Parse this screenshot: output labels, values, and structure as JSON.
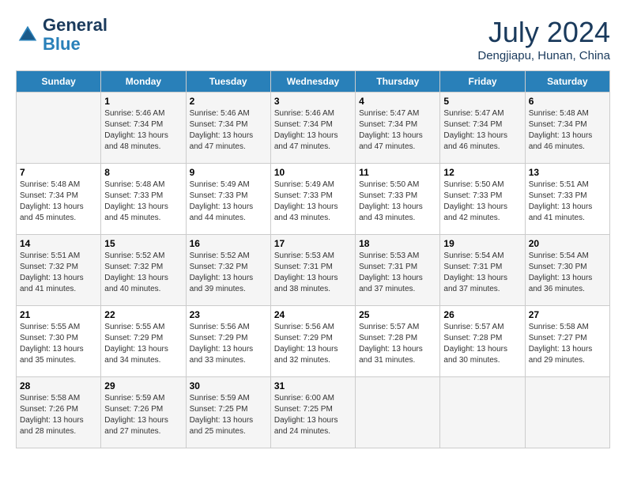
{
  "header": {
    "logo_line1": "General",
    "logo_line2": "Blue",
    "month_title": "July 2024",
    "location": "Dengjiapu, Hunan, China"
  },
  "calendar": {
    "days_of_week": [
      "Sunday",
      "Monday",
      "Tuesday",
      "Wednesday",
      "Thursday",
      "Friday",
      "Saturday"
    ],
    "weeks": [
      [
        {
          "day": "",
          "content": ""
        },
        {
          "day": "1",
          "content": "Sunrise: 5:46 AM\nSunset: 7:34 PM\nDaylight: 13 hours\nand 48 minutes."
        },
        {
          "day": "2",
          "content": "Sunrise: 5:46 AM\nSunset: 7:34 PM\nDaylight: 13 hours\nand 47 minutes."
        },
        {
          "day": "3",
          "content": "Sunrise: 5:46 AM\nSunset: 7:34 PM\nDaylight: 13 hours\nand 47 minutes."
        },
        {
          "day": "4",
          "content": "Sunrise: 5:47 AM\nSunset: 7:34 PM\nDaylight: 13 hours\nand 47 minutes."
        },
        {
          "day": "5",
          "content": "Sunrise: 5:47 AM\nSunset: 7:34 PM\nDaylight: 13 hours\nand 46 minutes."
        },
        {
          "day": "6",
          "content": "Sunrise: 5:48 AM\nSunset: 7:34 PM\nDaylight: 13 hours\nand 46 minutes."
        }
      ],
      [
        {
          "day": "7",
          "content": "Sunrise: 5:48 AM\nSunset: 7:34 PM\nDaylight: 13 hours\nand 45 minutes."
        },
        {
          "day": "8",
          "content": "Sunrise: 5:48 AM\nSunset: 7:33 PM\nDaylight: 13 hours\nand 45 minutes."
        },
        {
          "day": "9",
          "content": "Sunrise: 5:49 AM\nSunset: 7:33 PM\nDaylight: 13 hours\nand 44 minutes."
        },
        {
          "day": "10",
          "content": "Sunrise: 5:49 AM\nSunset: 7:33 PM\nDaylight: 13 hours\nand 43 minutes."
        },
        {
          "day": "11",
          "content": "Sunrise: 5:50 AM\nSunset: 7:33 PM\nDaylight: 13 hours\nand 43 minutes."
        },
        {
          "day": "12",
          "content": "Sunrise: 5:50 AM\nSunset: 7:33 PM\nDaylight: 13 hours\nand 42 minutes."
        },
        {
          "day": "13",
          "content": "Sunrise: 5:51 AM\nSunset: 7:33 PM\nDaylight: 13 hours\nand 41 minutes."
        }
      ],
      [
        {
          "day": "14",
          "content": "Sunrise: 5:51 AM\nSunset: 7:32 PM\nDaylight: 13 hours\nand 41 minutes."
        },
        {
          "day": "15",
          "content": "Sunrise: 5:52 AM\nSunset: 7:32 PM\nDaylight: 13 hours\nand 40 minutes."
        },
        {
          "day": "16",
          "content": "Sunrise: 5:52 AM\nSunset: 7:32 PM\nDaylight: 13 hours\nand 39 minutes."
        },
        {
          "day": "17",
          "content": "Sunrise: 5:53 AM\nSunset: 7:31 PM\nDaylight: 13 hours\nand 38 minutes."
        },
        {
          "day": "18",
          "content": "Sunrise: 5:53 AM\nSunset: 7:31 PM\nDaylight: 13 hours\nand 37 minutes."
        },
        {
          "day": "19",
          "content": "Sunrise: 5:54 AM\nSunset: 7:31 PM\nDaylight: 13 hours\nand 37 minutes."
        },
        {
          "day": "20",
          "content": "Sunrise: 5:54 AM\nSunset: 7:30 PM\nDaylight: 13 hours\nand 36 minutes."
        }
      ],
      [
        {
          "day": "21",
          "content": "Sunrise: 5:55 AM\nSunset: 7:30 PM\nDaylight: 13 hours\nand 35 minutes."
        },
        {
          "day": "22",
          "content": "Sunrise: 5:55 AM\nSunset: 7:29 PM\nDaylight: 13 hours\nand 34 minutes."
        },
        {
          "day": "23",
          "content": "Sunrise: 5:56 AM\nSunset: 7:29 PM\nDaylight: 13 hours\nand 33 minutes."
        },
        {
          "day": "24",
          "content": "Sunrise: 5:56 AM\nSunset: 7:29 PM\nDaylight: 13 hours\nand 32 minutes."
        },
        {
          "day": "25",
          "content": "Sunrise: 5:57 AM\nSunset: 7:28 PM\nDaylight: 13 hours\nand 31 minutes."
        },
        {
          "day": "26",
          "content": "Sunrise: 5:57 AM\nSunset: 7:28 PM\nDaylight: 13 hours\nand 30 minutes."
        },
        {
          "day": "27",
          "content": "Sunrise: 5:58 AM\nSunset: 7:27 PM\nDaylight: 13 hours\nand 29 minutes."
        }
      ],
      [
        {
          "day": "28",
          "content": "Sunrise: 5:58 AM\nSunset: 7:26 PM\nDaylight: 13 hours\nand 28 minutes."
        },
        {
          "day": "29",
          "content": "Sunrise: 5:59 AM\nSunset: 7:26 PM\nDaylight: 13 hours\nand 27 minutes."
        },
        {
          "day": "30",
          "content": "Sunrise: 5:59 AM\nSunset: 7:25 PM\nDaylight: 13 hours\nand 25 minutes."
        },
        {
          "day": "31",
          "content": "Sunrise: 6:00 AM\nSunset: 7:25 PM\nDaylight: 13 hours\nand 24 minutes."
        },
        {
          "day": "",
          "content": ""
        },
        {
          "day": "",
          "content": ""
        },
        {
          "day": "",
          "content": ""
        }
      ]
    ]
  }
}
